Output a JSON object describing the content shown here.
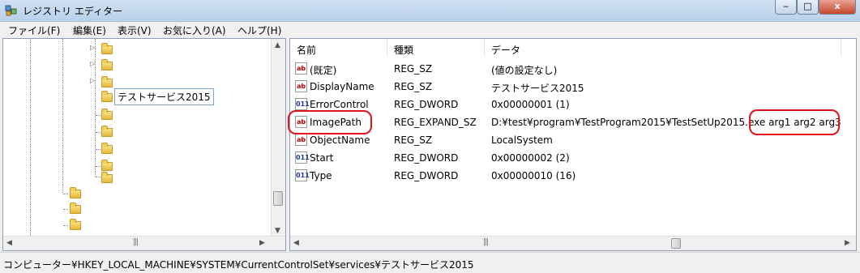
{
  "window": {
    "title": "レジストリ エディター",
    "min": "‒",
    "max": "□",
    "close": "x"
  },
  "menu": [
    "ファイル(F)",
    "編集(E)",
    "表示(V)",
    "お気に入り(A)",
    "ヘルプ(H)"
  ],
  "tree": {
    "selected_label": "テストサービス2015"
  },
  "columns": {
    "name": "名前",
    "type": "種類",
    "data": "データ"
  },
  "values": [
    {
      "icon": "string-value-icon",
      "name": "(既定)",
      "type": "REG_SZ",
      "data": "(値の設定なし)"
    },
    {
      "icon": "string-value-icon",
      "name": "DisplayName",
      "type": "REG_SZ",
      "data": "テストサービス2015"
    },
    {
      "icon": "binary-value-icon",
      "name": "ErrorControl",
      "type": "REG_DWORD",
      "data": "0x00000001 (1)"
    },
    {
      "icon": "string-value-icon",
      "name": "ImagePath",
      "type": "REG_EXPAND_SZ",
      "data": "D:¥test¥program¥TestProgram2015¥TestSetUp2015.exe arg1 arg2 arg3"
    },
    {
      "icon": "string-value-icon",
      "name": "ObjectName",
      "type": "REG_SZ",
      "data": "LocalSystem"
    },
    {
      "icon": "binary-value-icon",
      "name": "Start",
      "type": "REG_DWORD",
      "data": "0x00000002 (2)"
    },
    {
      "icon": "binary-value-icon",
      "name": "Type",
      "type": "REG_DWORD",
      "data": "0x00000010 (16)"
    }
  ],
  "icon_glyphs": {
    "string": "ab",
    "binary": "011"
  },
  "status": {
    "path": "コンピューター¥HKEY_LOCAL_MACHINE¥SYSTEM¥CurrentControlSet¥services¥テストサービス2015"
  },
  "colors": {
    "highlight": "#e0151b",
    "titlebar": "#b9d1ea"
  }
}
